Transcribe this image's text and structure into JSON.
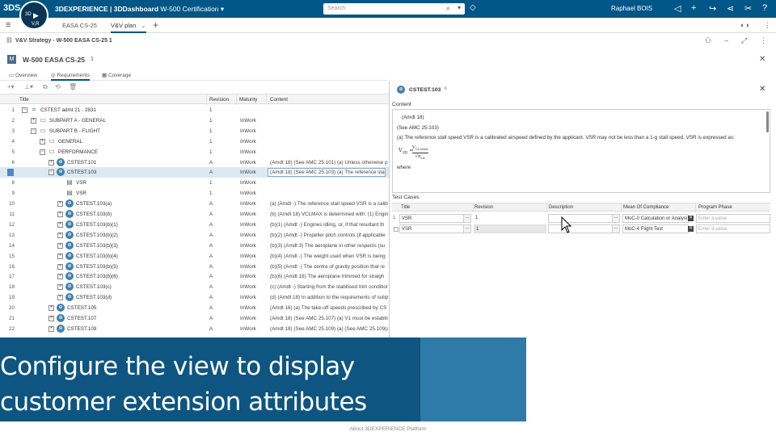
{
  "topbar": {
    "logo": "3DS",
    "compass_label": "3D",
    "compass_sub": "V,R",
    "brand": "3DEXPERIENCE | 3DDashboard",
    "dashboard_name": "W-500 Certification",
    "search_placeholder": "Search",
    "user": "Raphael BOIS"
  },
  "tabs": {
    "items": [
      {
        "label": "EASA CS-25"
      },
      {
        "label": "V&V plan"
      }
    ]
  },
  "widget": {
    "title": "V&V Strategy - W-500 EASA CS-25 1"
  },
  "object": {
    "name": "W-500 EASA CS-25",
    "revision": "1"
  },
  "subtabs": [
    {
      "label": "Overview"
    },
    {
      "label": "Requirements"
    },
    {
      "label": "Coverage"
    }
  ],
  "table": {
    "columns": [
      "Title",
      "Revision",
      "Maturity",
      "Content"
    ],
    "rows": [
      {
        "n": "1",
        "title": "CSTEST admt 21 - 2831",
        "rev": "1",
        "mat": "",
        "content": ""
      },
      {
        "n": "2",
        "title": "SUBPART A - GENERAL",
        "rev": "1",
        "mat": "InWork",
        "content": ""
      },
      {
        "n": "3",
        "title": "SUBPART B - FLIGHT",
        "rev": "1",
        "mat": "InWork",
        "content": ""
      },
      {
        "n": "4",
        "title": "GENERAL",
        "rev": "1",
        "mat": "InWork",
        "content": ""
      },
      {
        "n": "5",
        "title": "PERFORMANCE",
        "rev": "1",
        "mat": "InWork",
        "content": ""
      },
      {
        "n": "6",
        "title": "CSTEST.101",
        "rev": "A",
        "mat": "InWork",
        "content": "(Amdt 18) (See AMC 25.101) (a) Unless otherwise presc"
      },
      {
        "n": "7",
        "title": "CSTEST.103",
        "rev": "A",
        "mat": "InWork",
        "content": "(Amdt 18) (See AMC 25.103) (a) The reference stall sp"
      },
      {
        "n": "8",
        "title": "VSR",
        "rev": "1",
        "mat": "InWork",
        "content": ""
      },
      {
        "n": "9",
        "title": "VSR",
        "rev": "1",
        "mat": "InWork",
        "content": ""
      },
      {
        "n": "10",
        "title": "CSTEST.103(a)",
        "rev": "A",
        "mat": "InWork",
        "content": "(a)   (Amdt -) The reference stall speed VSR is a calib"
      },
      {
        "n": "11",
        "title": "CSTEST.103(b)",
        "rev": "A",
        "mat": "InWork",
        "content": "(b)   (Amdt 18) VCLMAX is determined with: (1) Engin"
      },
      {
        "n": "12",
        "title": "CSTEST.103(b)(1)",
        "rev": "A",
        "mat": "InWork",
        "content": "(b)(1)      (Amdt -) Engines idling, or, if that resultant th"
      },
      {
        "n": "13",
        "title": "CSTEST.103(b)(2)",
        "rev": "A",
        "mat": "InWork",
        "content": "(b)(2)      (Amdt -) Propeller pitch controls (if applicable"
      },
      {
        "n": "14",
        "title": "CSTEST.103(b)(3)",
        "rev": "A",
        "mat": "InWork",
        "content": "(b)(3)      (Amdt 3) The aeroplane in other respects (su"
      },
      {
        "n": "15",
        "title": "CSTEST.103(b)(4)",
        "rev": "A",
        "mat": "InWork",
        "content": "(b)(4)      (Amdt -) The weight used when VSR is being"
      },
      {
        "n": "16",
        "title": "CSTEST.103(b)(5)",
        "rev": "A",
        "mat": "InWork",
        "content": "(b)(5)      (Amdt -) The centre of gravity position that re"
      },
      {
        "n": "17",
        "title": "CSTEST.103(b)(6)",
        "rev": "A",
        "mat": "InWork",
        "content": "(b)(6)      (Amdt 18) The aeroplane trimmed for straigh"
      },
      {
        "n": "18",
        "title": "CSTEST.103(c)",
        "rev": "A",
        "mat": "InWork",
        "content": "(c)   (Amdt -) Starting from the stabilised trim condition"
      },
      {
        "n": "19",
        "title": "CSTEST.103(d)",
        "rev": "A",
        "mat": "InWork",
        "content": "(d)   (Amdt 18) In addition to the requirements of subpa"
      },
      {
        "n": "20",
        "title": "CSTEST.105",
        "rev": "A",
        "mat": "InWork",
        "content": "(Amdt 16) (a) The take-off speeds prescribed by CS 25"
      },
      {
        "n": "21",
        "title": "CSTEST.107",
        "rev": "A",
        "mat": "InWork",
        "content": "(Amdt 18) (See AMC 25.107) (a) V1 must be establishe"
      },
      {
        "n": "22",
        "title": "CSTEST.109",
        "rev": "A",
        "mat": "InWork",
        "content": "(Amdt 18) (See AMC 25.109) (a)  (See AMC 25.109(a)"
      }
    ]
  },
  "panel": {
    "title": "CSTEST.103",
    "content_label": "Content",
    "content_lines": [
      "(Amdt 18)",
      "(See AMC 25.103)",
      "(a) The reference stall speed VSR is a calibrated airspeed defined by the applicant. VSR may not be less than a 1-g stall speed. VSR is expressed as:"
    ],
    "formula_lhs": "V",
    "formula_lhs_sub": "SR",
    "formula_num": "V",
    "formula_num_sub": "CLMAX",
    "formula_den": "√n",
    "formula_den_sub": "zw",
    "where": "where",
    "test_cases_label": "Test Cases",
    "tc_columns": [
      "Title",
      "Revision",
      "Description",
      "Mean Of Compliance",
      "Program Phase"
    ],
    "tc_rows": [
      {
        "idx": "1",
        "title": "VSR",
        "rev": "1",
        "desc": "",
        "moc": "MoC-0 Calculation or Analysi",
        "phase": "Enter a value"
      },
      {
        "idx": "",
        "title": "VSR",
        "rev": "1",
        "desc": "",
        "moc": "MoC-4 Flight Test",
        "phase": "Enter a value"
      }
    ]
  },
  "caption": {
    "line1": "Configure the view to display",
    "line2": "customer extension attributes"
  },
  "footer": "About 3DEXPERIENCE Platform",
  "colors": {
    "topbar": "#005686",
    "caption": "#0e5581",
    "caption_accent": "#2e7aa8",
    "selected_row": "#dce9f5"
  }
}
